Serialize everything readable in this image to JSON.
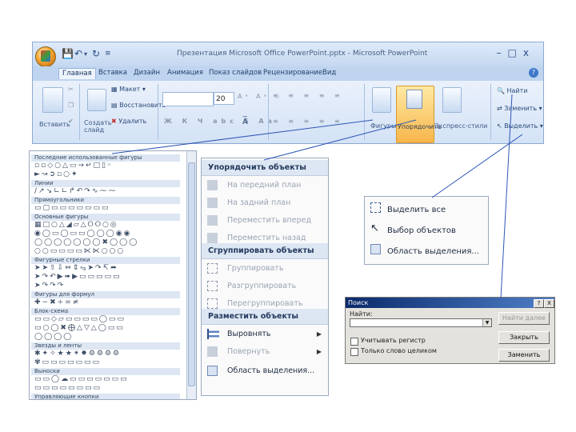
{
  "ribbon": {
    "window_title": "Презентация Microsoft Office PowerPoint.pptx - Microsoft PowerPoint",
    "tabs": [
      "Главная",
      "Вставка",
      "Дизайн",
      "Анимация",
      "Показ слайдов",
      "Рецензирование",
      "Вид"
    ],
    "active_tab": "Главная",
    "paste_label": "Вставить",
    "new_slide_label": "Создать слайд",
    "layout_label": "Макет",
    "reset_label": "Восстановить",
    "delete_label": "Удалить",
    "font_size": "20",
    "shapes_label": "Фигуры",
    "arrange_label": "Упорядочить",
    "quick_styles_label": "Экспресс-стили",
    "find_label": "Найти",
    "replace_label": "Заменить",
    "select_label": "Выделить"
  },
  "shapes_gallery": {
    "categories": [
      "Последние использованные фигуры",
      "Линии",
      "Прямоугольники",
      "Основные фигуры",
      "Фигурные стрелки",
      "Фигуры для формул",
      "Блок-схема",
      "Звезды и ленты",
      "Выноски",
      "Управляющие кнопки"
    ]
  },
  "arrange_menu": {
    "order_header": "Упорядочить объекты",
    "bring_to_front": "На передний план",
    "send_to_back": "На задний план",
    "bring_forward": "Переместить вперед",
    "send_backward": "Переместить назад",
    "group_header": "Сгруппировать объекты",
    "group": "Группировать",
    "ungroup": "Разгруппировать",
    "regroup": "Перегруппировать",
    "position_header": "Разместить объекты",
    "align": "Выровнять",
    "rotate": "Повернуть",
    "selection_pane": "Область выделения..."
  },
  "select_menu": {
    "select_all": "Выделить все",
    "select_objects": "Выбор объектов",
    "selection_pane": "Область выделения..."
  },
  "find_dialog": {
    "title": "Поиск",
    "find_label": "Найти:",
    "find_value": "",
    "find_next": "Найти далее",
    "close": "Закрыть",
    "replace": "Заменить",
    "match_case": "Учитывать регистр",
    "whole_words": "Только слово целиком",
    "help_button": "?",
    "close_button": "X"
  }
}
